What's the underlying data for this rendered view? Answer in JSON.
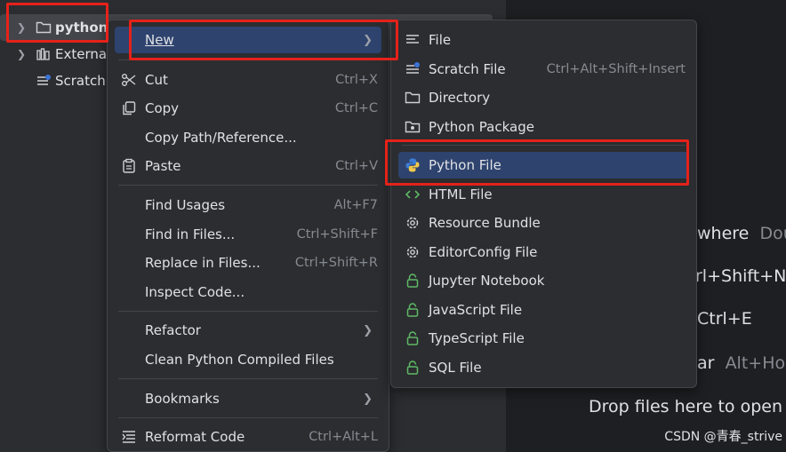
{
  "tree": {
    "project_label": "python",
    "external_label": "Externa",
    "scratch_label": "Scratch"
  },
  "main_menu": {
    "new": "New",
    "cut": "Cut",
    "cut_sc": "Ctrl+X",
    "copy": "Copy",
    "copy_sc": "Ctrl+C",
    "copy_path": "Copy Path/Reference...",
    "paste": "Paste",
    "paste_sc": "Ctrl+V",
    "find_usages": "Find Usages",
    "find_usages_sc": "Alt+F7",
    "find_in_files": "Find in Files...",
    "find_in_files_sc": "Ctrl+Shift+F",
    "replace_in_files": "Replace in Files...",
    "replace_in_files_sc": "Ctrl+Shift+R",
    "inspect_code": "Inspect Code...",
    "refactor": "Refactor",
    "clean_compiled": "Clean Python Compiled Files",
    "bookmarks": "Bookmarks",
    "reformat": "Reformat Code",
    "reformat_sc": "Ctrl+Alt+L"
  },
  "sub_menu": {
    "file": "File",
    "scratch_file": "Scratch File",
    "scratch_file_sc": "Ctrl+Alt+Shift+Insert",
    "directory": "Directory",
    "python_package": "Python Package",
    "python_file": "Python File",
    "html_file": "HTML File",
    "resource_bundle": "Resource Bundle",
    "editorconfig": "EditorConfig File",
    "jupyter": "Jupyter Notebook",
    "javascript": "JavaScript File",
    "typescript": "TypeScript File",
    "sql": "SQL File"
  },
  "editor_hints": {
    "where": "where",
    "where_key": "Dou",
    "line2": "rl+Shift+N",
    "line3": "Ctrl+E",
    "ar": "ar",
    "ar_key": "Alt+Ho",
    "drop": "Drop files here to open"
  },
  "watermark": "CSDN @青春_strive",
  "colors": {
    "highlight_red": "#e5221a",
    "selection_blue": "#2e436e",
    "menu_bg": "#2b2d30"
  }
}
